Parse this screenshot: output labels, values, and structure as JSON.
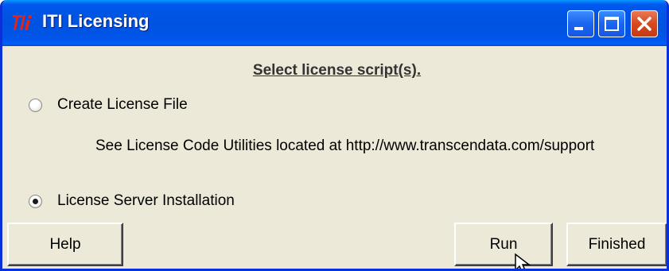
{
  "window": {
    "title": "ITI Licensing",
    "icon_name": "iti-app-icon",
    "accent_color": "#0054e3"
  },
  "caption_buttons": {
    "minimize_icon": "minimize-icon",
    "maximize_icon": "maximize-icon",
    "close_icon": "close-icon"
  },
  "content": {
    "heading": "Select license script(s).",
    "options": [
      {
        "label": "Create License File",
        "selected": false
      },
      {
        "label": "License Server Installation",
        "selected": true
      }
    ],
    "note": "See License Code Utilities located at http://www.transcendata.com/support"
  },
  "buttons": {
    "help": "Help",
    "run": "Run",
    "finished": "Finished"
  }
}
